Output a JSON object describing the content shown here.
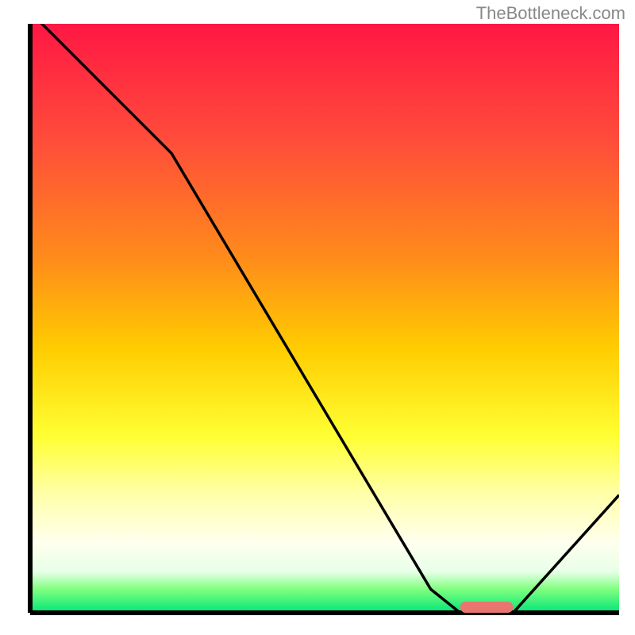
{
  "watermark": "TheBottleneck.com",
  "chart_data": {
    "type": "line",
    "title": "",
    "xlabel": "",
    "ylabel": "",
    "xlim": [
      0,
      100
    ],
    "ylim": [
      0,
      100
    ],
    "x": [
      0,
      4,
      24,
      68,
      73,
      82,
      100
    ],
    "values": [
      102,
      98,
      78,
      4,
      0,
      0,
      20
    ],
    "optimal_marker": {
      "x_start": 73,
      "x_end": 82,
      "color": "#e8766f"
    },
    "gradient_stops": [
      {
        "offset": 0,
        "color": "#ff1744"
      },
      {
        "offset": 20,
        "color": "#ff4d3a"
      },
      {
        "offset": 40,
        "color": "#ff8c1a"
      },
      {
        "offset": 55,
        "color": "#ffcc00"
      },
      {
        "offset": 70,
        "color": "#ffff33"
      },
      {
        "offset": 80,
        "color": "#ffffaa"
      },
      {
        "offset": 88,
        "color": "#ffffee"
      },
      {
        "offset": 93,
        "color": "#e8ffe8"
      },
      {
        "offset": 96,
        "color": "#80ff80"
      },
      {
        "offset": 100,
        "color": "#00e676"
      }
    ],
    "axis_color": "#000000",
    "curve_color": "#000000"
  }
}
